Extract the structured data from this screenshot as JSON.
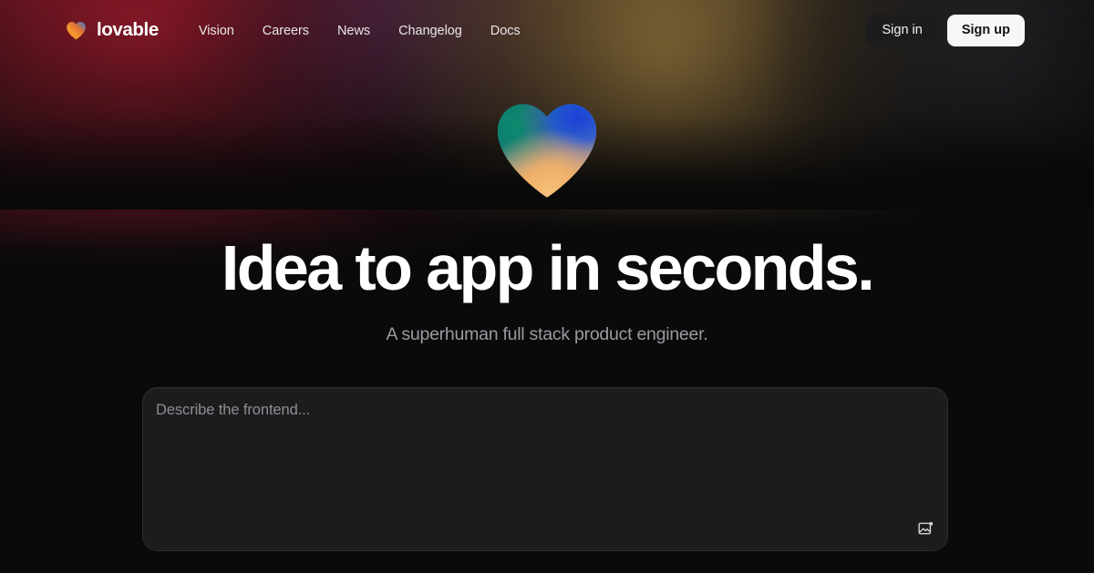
{
  "brand": {
    "name": "lovable",
    "logo_icon": "heart-logo-icon",
    "logo_gradient": {
      "from": "#f26c2a",
      "mid": "#f0a23a",
      "to": "#2f7de1"
    }
  },
  "header": {
    "nav": [
      {
        "label": "Vision",
        "name": "nav-link-vision"
      },
      {
        "label": "Careers",
        "name": "nav-link-careers"
      },
      {
        "label": "News",
        "name": "nav-link-news"
      },
      {
        "label": "Changelog",
        "name": "nav-link-changelog"
      },
      {
        "label": "Docs",
        "name": "nav-link-docs"
      }
    ],
    "sign_in_label": "Sign in",
    "sign_up_label": "Sign up"
  },
  "hero": {
    "heart_icon": "heart-hero-icon",
    "heart_gradient": {
      "teal": "#0d7a6d",
      "green": "#1e8f6a",
      "blue": "#1b46c8",
      "blue_light": "#2f6fe0",
      "peach": "#f0b068",
      "amber": "#f2bd7a"
    },
    "headline": "Idea to app in seconds.",
    "subtitle": "A superhuman full stack product engineer."
  },
  "prompt": {
    "placeholder": "Describe the frontend...",
    "value": "",
    "attach_icon": "image-upload-icon"
  },
  "colors": {
    "background": "#0a0a0b",
    "panel": "#1c1c1e",
    "panel_border": "#2e2e31",
    "text_primary": "#ffffff",
    "text_muted": "#9a9ba1",
    "placeholder": "#8e8e93",
    "glow_red": "#961a2a",
    "glow_amber": "#b28c48",
    "signup_bg": "#f7f7f7"
  }
}
